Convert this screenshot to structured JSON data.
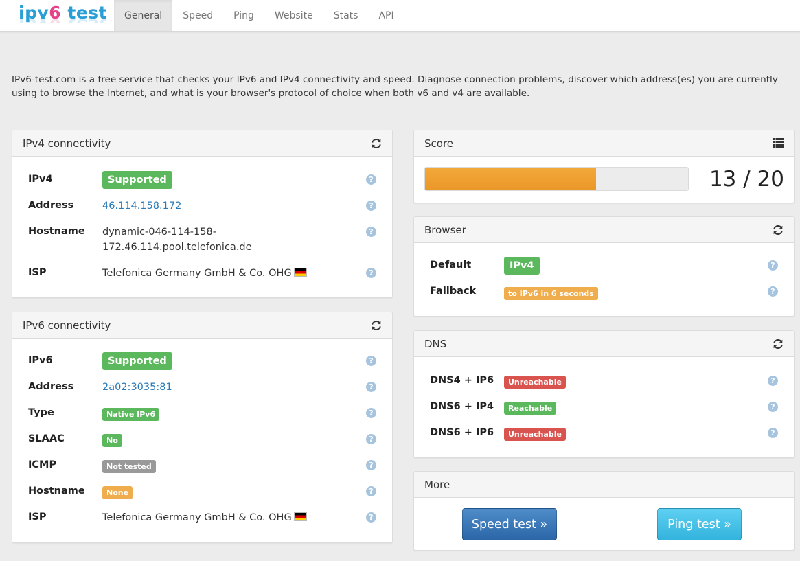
{
  "brand": {
    "part1": "ipv",
    "part2": "6",
    "part3": " test"
  },
  "nav": {
    "items": [
      "General",
      "Speed",
      "Ping",
      "Website",
      "Stats",
      "API"
    ],
    "active": "General"
  },
  "intro": "IPv6-test.com is a free service that checks your IPv6 and IPv4 connectivity and speed. Diagnose connection problems, discover which address(es) you are currently using to browse the Internet, and what is your browser's protocol of choice when both v6 and v4 are available.",
  "ipv4": {
    "title": "IPv4 connectivity",
    "rows": {
      "ipv4": {
        "label": "IPv4",
        "value": "Supported"
      },
      "address": {
        "label": "Address",
        "value": "46.114.158.172"
      },
      "hostname": {
        "label": "Hostname",
        "value_line1": "dynamic-046-114-158-",
        "value_line2": "172.46.114.pool.telefonica.de"
      },
      "isp": {
        "label": "ISP",
        "value": "Telefonica Germany GmbH & Co. OHG"
      }
    }
  },
  "ipv6": {
    "title": "IPv6 connectivity",
    "rows": {
      "ipv6": {
        "label": "IPv6",
        "value": "Supported"
      },
      "address": {
        "label": "Address",
        "value": "2a02:3035:81"
      },
      "type": {
        "label": "Type",
        "value": "Native IPv6"
      },
      "slaac": {
        "label": "SLAAC",
        "value": "No"
      },
      "icmp": {
        "label": "ICMP",
        "value": "Not tested"
      },
      "hostname": {
        "label": "Hostname",
        "value": "None"
      },
      "isp": {
        "label": "ISP",
        "value": "Telefonica Germany GmbH & Co. OHG"
      }
    }
  },
  "score": {
    "title": "Score",
    "text": "13 / 20",
    "value": 13,
    "max": 20,
    "fill_fraction": 0.65
  },
  "browser": {
    "title": "Browser",
    "default_label": "Default",
    "default_value": "IPv4",
    "fallback_label": "Fallback",
    "fallback_value": "to IPv6 in 6 seconds"
  },
  "dns": {
    "title": "DNS",
    "rows": [
      {
        "label": "DNS4 + IP6",
        "value": "Unreachable"
      },
      {
        "label": "DNS6 + IP4",
        "value": "Reachable"
      },
      {
        "label": "DNS6 + IP6",
        "value": "Unreachable"
      }
    ]
  },
  "more": {
    "title": "More",
    "speed_button": "Speed test »",
    "ping_button": "Ping test »"
  },
  "help_glyph": "?",
  "colors": {
    "success": "#5cb85c",
    "danger": "#d9534f",
    "warning": "#f0ad4e",
    "default": "#999999",
    "progress": "#ea9728",
    "link": "#2a7ab8",
    "brand_blue": "#2a9fd6",
    "brand_pink": "#e5428a"
  }
}
